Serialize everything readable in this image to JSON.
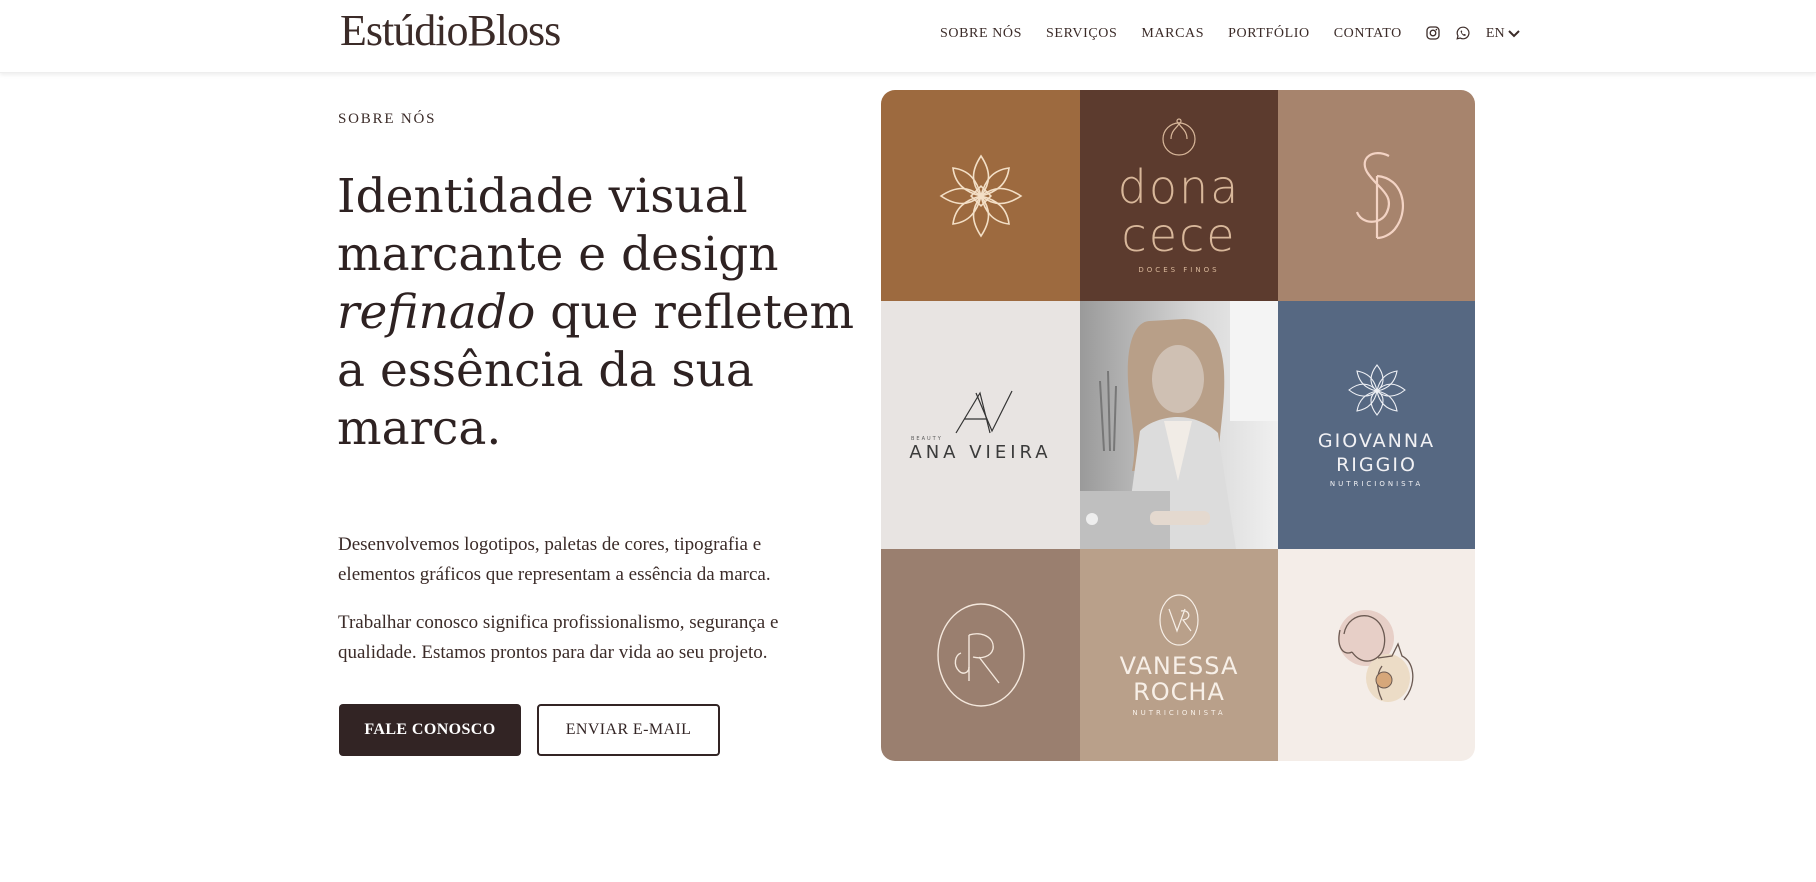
{
  "header": {
    "logo": "EstúdioBloss",
    "nav": [
      "SOBRE NÓS",
      "SERVIÇOS",
      "MARCAS",
      "PORTFÓLIO",
      "CONTATO"
    ],
    "icons": [
      "instagram-icon",
      "whatsapp-icon"
    ],
    "language": "EN"
  },
  "hero": {
    "eyebrow": "SOBRE NÓS",
    "headline_part1": "Identidade visual marcante e design",
    "headline_italic": "refinado",
    "headline_part2": "que refletem a essência da sua marca.",
    "paragraph1": "Desenvolvemos logotipos, paletas de cores, tipografia e elementos gráficos que representam a essência da marca.",
    "paragraph2": "Trabalhar conosco significa profissionalismo, segurança e qualidade. Estamos prontos para dar vida ao seu projeto.",
    "button_primary": "FALE CONOSCO",
    "button_secondary": "ENVIAR E-MAIL"
  },
  "portfolio": {
    "tiles": [
      {
        "name": "flower-logo",
        "color": "#9d6a3f"
      },
      {
        "name": "dona-cece",
        "text": "dona cece",
        "subtext": "DOCES FINOS",
        "color": "#5c3b2e"
      },
      {
        "name": "sd-monogram",
        "color": "#a7846d"
      },
      {
        "name": "ana-vieira",
        "text": "ANA VIEIRA",
        "subtext": "BEAUTY",
        "color": "#e8e4e2"
      },
      {
        "name": "photo-woman-laptop",
        "color": "#8e8e8e"
      },
      {
        "name": "giovanna-riggio",
        "text_line1": "GIOVANNA",
        "text_line2": "RIGGIO",
        "subtext": "NUTRICIONISTA",
        "color": "#566882"
      },
      {
        "name": "dr-monogram",
        "color": "#9a7f6f"
      },
      {
        "name": "vanessa-rocha",
        "text_line1": "VANESSA",
        "text_line2": "ROCHA",
        "subtext": "NUTRICIONISTA",
        "color": "#b9a08a"
      },
      {
        "name": "pet-illustration",
        "color": "#f4ede8"
      }
    ]
  }
}
